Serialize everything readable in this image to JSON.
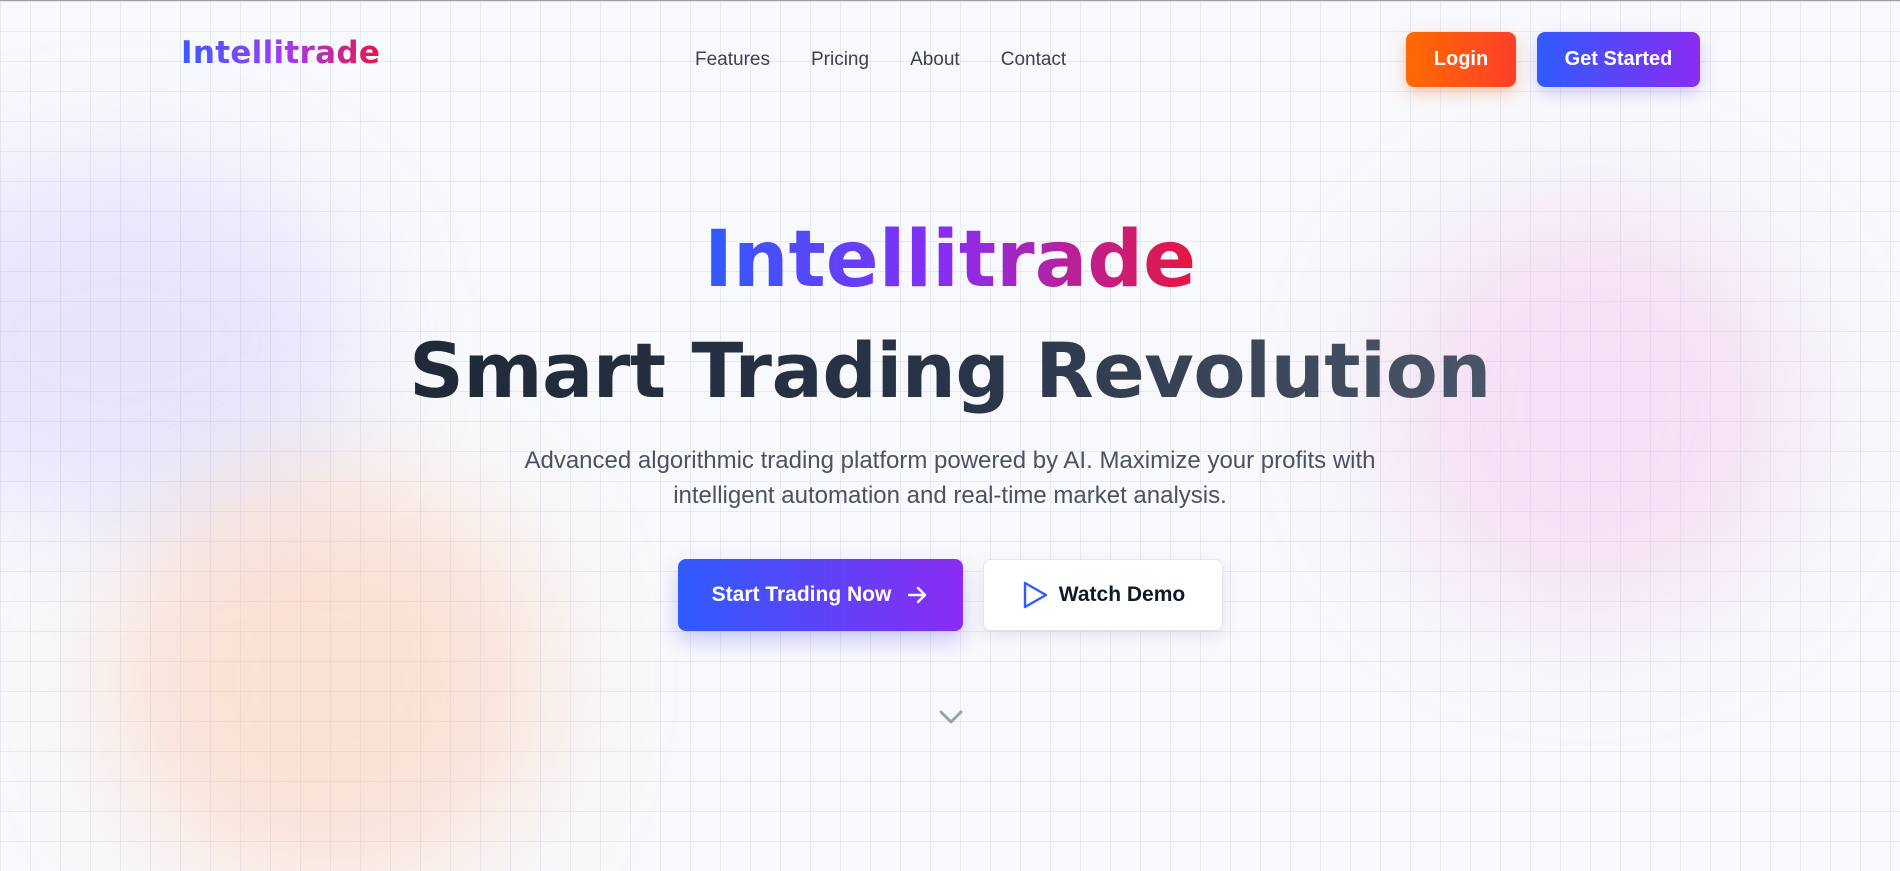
{
  "header": {
    "logo_text": "Intellitrade",
    "nav": [
      {
        "label": "Features"
      },
      {
        "label": "Pricing"
      },
      {
        "label": "About"
      },
      {
        "label": "Contact"
      }
    ],
    "login_label": "Login",
    "get_started_label": "Get Started"
  },
  "hero": {
    "brand": "Intellitrade",
    "title": "Smart Trading Revolution",
    "subtitle": "Advanced algorithmic trading platform powered by AI. Maximize your profits with intelligent automation and real-time market analysis.",
    "primary_cta": "Start Trading Now",
    "primary_cta_icon": "arrow-right-icon",
    "secondary_cta": "Watch Demo",
    "secondary_cta_icon": "play-icon",
    "scroll_icon": "chevron-down-icon"
  },
  "colors": {
    "brand_gradient": [
      "#2f5bff",
      "#8a2cf2",
      "#e8163d"
    ],
    "login_gradient": [
      "#ff6a00",
      "#ff3f2a"
    ],
    "text_dark": "#1f2937",
    "text_muted": "#4b5263"
  }
}
